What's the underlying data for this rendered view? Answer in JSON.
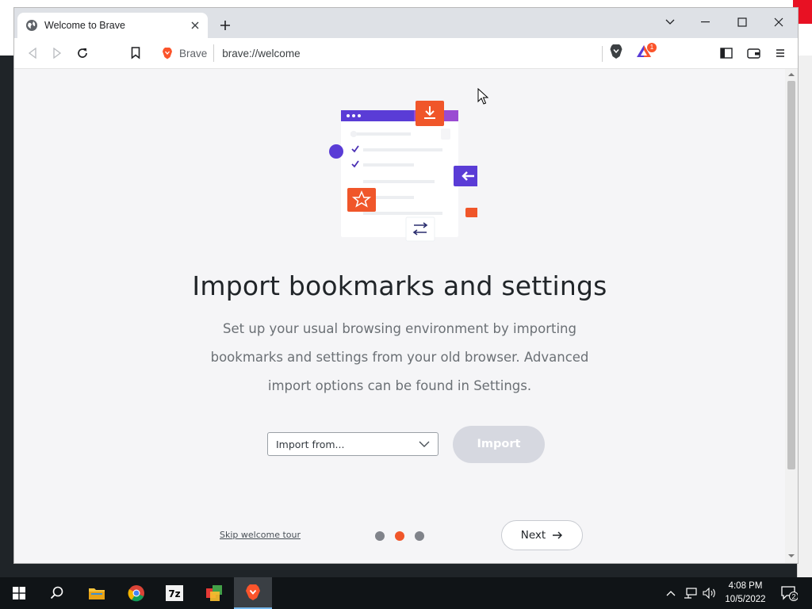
{
  "browser": {
    "tab_title": "Welcome to Brave",
    "omnibox_brand": "Brave",
    "url": "brave://welcome",
    "rewards_badge": "1"
  },
  "page": {
    "title": "Import bookmarks and settings",
    "description": "Set up your usual browsing environment by importing bookmarks and settings from your old browser. Advanced import options can be found in Settings.",
    "import_select": "Import from...",
    "import_button": "Import",
    "skip_link": "Skip welcome tour",
    "next_button": "Next",
    "steps": {
      "total": 3,
      "current": 2
    }
  },
  "taskbar": {
    "apps": [
      "start-icon",
      "search-icon",
      "file-explorer-icon",
      "chrome-icon",
      "7zip-icon",
      "app-icon",
      "brave-icon"
    ],
    "time": "4:08 PM",
    "date": "10/5/2022",
    "notification_count": "2"
  },
  "colors": {
    "brave_orange": "#fb542b",
    "purple": "#5a3cd6",
    "dot_inactive": "#80838a",
    "dot_active": "#f0562a"
  }
}
